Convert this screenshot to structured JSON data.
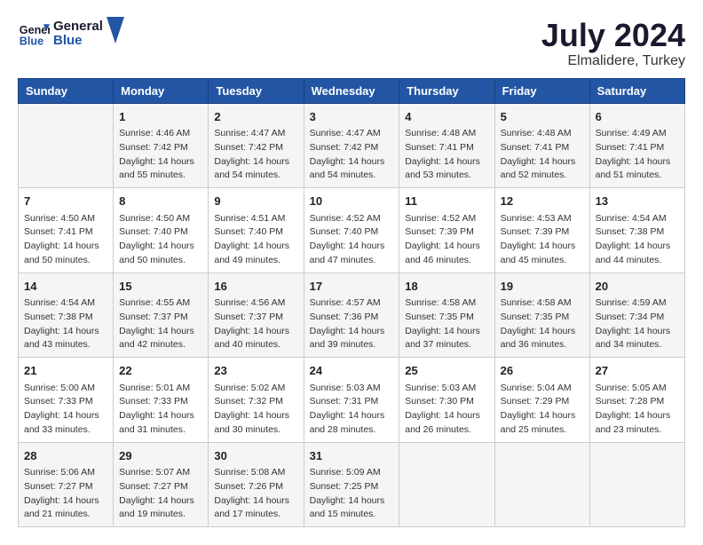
{
  "header": {
    "logo_text_general": "General",
    "logo_text_blue": "Blue",
    "month_year": "July 2024",
    "location": "Elmalidere, Turkey"
  },
  "days_of_week": [
    "Sunday",
    "Monday",
    "Tuesday",
    "Wednesday",
    "Thursday",
    "Friday",
    "Saturday"
  ],
  "weeks": [
    [
      {
        "day": "",
        "content": ""
      },
      {
        "day": "1",
        "content": "Sunrise: 4:46 AM\nSunset: 7:42 PM\nDaylight: 14 hours\nand 55 minutes."
      },
      {
        "day": "2",
        "content": "Sunrise: 4:47 AM\nSunset: 7:42 PM\nDaylight: 14 hours\nand 54 minutes."
      },
      {
        "day": "3",
        "content": "Sunrise: 4:47 AM\nSunset: 7:42 PM\nDaylight: 14 hours\nand 54 minutes."
      },
      {
        "day": "4",
        "content": "Sunrise: 4:48 AM\nSunset: 7:41 PM\nDaylight: 14 hours\nand 53 minutes."
      },
      {
        "day": "5",
        "content": "Sunrise: 4:48 AM\nSunset: 7:41 PM\nDaylight: 14 hours\nand 52 minutes."
      },
      {
        "day": "6",
        "content": "Sunrise: 4:49 AM\nSunset: 7:41 PM\nDaylight: 14 hours\nand 51 minutes."
      }
    ],
    [
      {
        "day": "7",
        "content": "Sunrise: 4:50 AM\nSunset: 7:41 PM\nDaylight: 14 hours\nand 50 minutes."
      },
      {
        "day": "8",
        "content": "Sunrise: 4:50 AM\nSunset: 7:40 PM\nDaylight: 14 hours\nand 50 minutes."
      },
      {
        "day": "9",
        "content": "Sunrise: 4:51 AM\nSunset: 7:40 PM\nDaylight: 14 hours\nand 49 minutes."
      },
      {
        "day": "10",
        "content": "Sunrise: 4:52 AM\nSunset: 7:40 PM\nDaylight: 14 hours\nand 47 minutes."
      },
      {
        "day": "11",
        "content": "Sunrise: 4:52 AM\nSunset: 7:39 PM\nDaylight: 14 hours\nand 46 minutes."
      },
      {
        "day": "12",
        "content": "Sunrise: 4:53 AM\nSunset: 7:39 PM\nDaylight: 14 hours\nand 45 minutes."
      },
      {
        "day": "13",
        "content": "Sunrise: 4:54 AM\nSunset: 7:38 PM\nDaylight: 14 hours\nand 44 minutes."
      }
    ],
    [
      {
        "day": "14",
        "content": "Sunrise: 4:54 AM\nSunset: 7:38 PM\nDaylight: 14 hours\nand 43 minutes."
      },
      {
        "day": "15",
        "content": "Sunrise: 4:55 AM\nSunset: 7:37 PM\nDaylight: 14 hours\nand 42 minutes."
      },
      {
        "day": "16",
        "content": "Sunrise: 4:56 AM\nSunset: 7:37 PM\nDaylight: 14 hours\nand 40 minutes."
      },
      {
        "day": "17",
        "content": "Sunrise: 4:57 AM\nSunset: 7:36 PM\nDaylight: 14 hours\nand 39 minutes."
      },
      {
        "day": "18",
        "content": "Sunrise: 4:58 AM\nSunset: 7:35 PM\nDaylight: 14 hours\nand 37 minutes."
      },
      {
        "day": "19",
        "content": "Sunrise: 4:58 AM\nSunset: 7:35 PM\nDaylight: 14 hours\nand 36 minutes."
      },
      {
        "day": "20",
        "content": "Sunrise: 4:59 AM\nSunset: 7:34 PM\nDaylight: 14 hours\nand 34 minutes."
      }
    ],
    [
      {
        "day": "21",
        "content": "Sunrise: 5:00 AM\nSunset: 7:33 PM\nDaylight: 14 hours\nand 33 minutes."
      },
      {
        "day": "22",
        "content": "Sunrise: 5:01 AM\nSunset: 7:33 PM\nDaylight: 14 hours\nand 31 minutes."
      },
      {
        "day": "23",
        "content": "Sunrise: 5:02 AM\nSunset: 7:32 PM\nDaylight: 14 hours\nand 30 minutes."
      },
      {
        "day": "24",
        "content": "Sunrise: 5:03 AM\nSunset: 7:31 PM\nDaylight: 14 hours\nand 28 minutes."
      },
      {
        "day": "25",
        "content": "Sunrise: 5:03 AM\nSunset: 7:30 PM\nDaylight: 14 hours\nand 26 minutes."
      },
      {
        "day": "26",
        "content": "Sunrise: 5:04 AM\nSunset: 7:29 PM\nDaylight: 14 hours\nand 25 minutes."
      },
      {
        "day": "27",
        "content": "Sunrise: 5:05 AM\nSunset: 7:28 PM\nDaylight: 14 hours\nand 23 minutes."
      }
    ],
    [
      {
        "day": "28",
        "content": "Sunrise: 5:06 AM\nSunset: 7:27 PM\nDaylight: 14 hours\nand 21 minutes."
      },
      {
        "day": "29",
        "content": "Sunrise: 5:07 AM\nSunset: 7:27 PM\nDaylight: 14 hours\nand 19 minutes."
      },
      {
        "day": "30",
        "content": "Sunrise: 5:08 AM\nSunset: 7:26 PM\nDaylight: 14 hours\nand 17 minutes."
      },
      {
        "day": "31",
        "content": "Sunrise: 5:09 AM\nSunset: 7:25 PM\nDaylight: 14 hours\nand 15 minutes."
      },
      {
        "day": "",
        "content": ""
      },
      {
        "day": "",
        "content": ""
      },
      {
        "day": "",
        "content": ""
      }
    ]
  ]
}
